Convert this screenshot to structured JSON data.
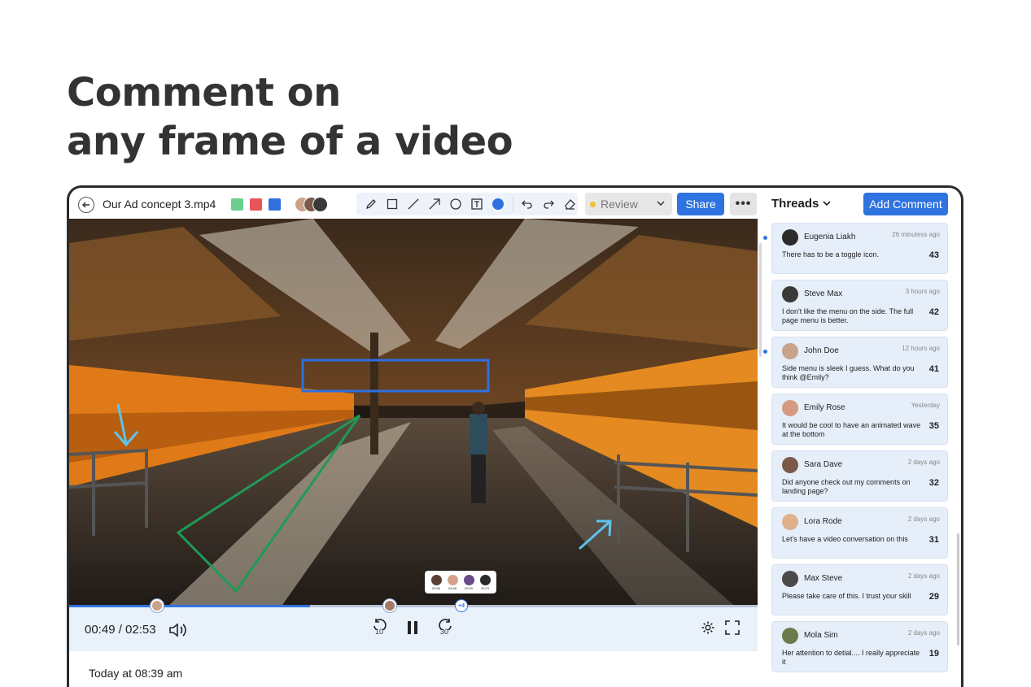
{
  "headline": {
    "line1": "Comment on",
    "line2": "any frame of a video"
  },
  "toolbar": {
    "file_name": "Our Ad concept 3.mp4",
    "swatches": [
      "#6ccf8e",
      "#e8555a",
      "#2f6fe0"
    ],
    "tools": [
      "pencil-icon",
      "rectangle-icon",
      "line-icon",
      "arrow-icon",
      "circle-icon",
      "text-icon",
      "color-dot-icon",
      "undo-icon",
      "redo-icon",
      "eraser-icon"
    ],
    "status": "Review",
    "share_label": "Share",
    "more_label": "•••"
  },
  "player": {
    "timecode": "00:49 / 02:53",
    "progress": 0.35,
    "rewind_label": "10",
    "forward_label": "30",
    "more_badge": "+4",
    "popover_times": [
      "09:56",
      "09:58",
      "09:59",
      "09:23"
    ]
  },
  "comment_timestamp": "Today at 08:39 am",
  "threads": {
    "title": "Threads",
    "add_label": "Add Comment",
    "items": [
      {
        "name": "Eugenia Liakh",
        "time": "26 minutess ago",
        "text": "There has to be a toggle icon.",
        "count": "43",
        "unread": true,
        "avatar": "#2b2b2b"
      },
      {
        "name": "Steve Max",
        "time": "3 hours ago",
        "text": "I don't like the menu on the side. The full page menu is better.",
        "count": "42",
        "unread": false,
        "avatar": "#3a3a3a"
      },
      {
        "name": "John Doe",
        "time": "12 hours ago",
        "text": "Side menu is sleek I guess. What do you think @Emily?",
        "count": "41",
        "unread": true,
        "avatar": "#c9a28a"
      },
      {
        "name": "Emily Rose",
        "time": "Yesterday",
        "text": "It would be cool to have an animated wave at the bottom",
        "count": "35",
        "unread": false,
        "avatar": "#d59b80"
      },
      {
        "name": "Sara Dave",
        "time": "2 days ago",
        "text": "Did anyone check out my comments on landing page?",
        "count": "32",
        "unread": false,
        "avatar": "#7b5a4a"
      },
      {
        "name": "Lora Rode",
        "time": "2 days ago",
        "text": "Let's have a video conversation on this",
        "count": "31",
        "unread": false,
        "avatar": "#e0b08d"
      },
      {
        "name": "Max Steve",
        "time": "2 days ago",
        "text": "Please take care of this. I trust your skill",
        "count": "29",
        "unread": false,
        "avatar": "#4a4a4a"
      },
      {
        "name": "Mola Sim",
        "time": "2 days ago",
        "text": "Her attention to detial.... I really appreciate it",
        "count": "19",
        "unread": false,
        "avatar": "#6b7c4a"
      }
    ]
  }
}
